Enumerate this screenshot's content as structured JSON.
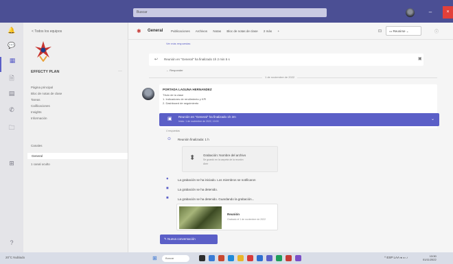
{
  "top_bar": {
    "search_text": "Buscar",
    "minimize_glyph": "–",
    "close_glyph": "×"
  },
  "rail": [
    {
      "icon": "bell-icon",
      "glyph": "🔔",
      "label": ""
    },
    {
      "icon": "chat-icon",
      "glyph": "💬",
      "label": ""
    },
    {
      "icon": "teams-icon",
      "glyph": "▦",
      "label": ""
    },
    {
      "icon": "assignments-icon",
      "glyph": "🗎",
      "label": ""
    },
    {
      "icon": "calendar-icon",
      "glyph": "▤",
      "label": ""
    },
    {
      "icon": "calls-icon",
      "glyph": "✆",
      "label": ""
    },
    {
      "icon": "files-icon",
      "glyph": "🗀",
      "label": ""
    },
    {
      "icon": "apps-icon",
      "glyph": "⊞",
      "label": ""
    },
    {
      "icon": "help-icon",
      "glyph": "?",
      "label": ""
    }
  ],
  "panel": {
    "back_label": "< Todos los equipos",
    "team_name": "EFFECTY PLAN",
    "more": "···",
    "nav_items": [
      "Página principal",
      "Bloc de notas de clase",
      "Tareas",
      "Calificaciones",
      "Insights",
      "Información"
    ],
    "channels_header": "Canales",
    "active_channel": "General",
    "hidden_channels": "1 canal oculto"
  },
  "channel": {
    "title": "General",
    "tabs": [
      "Publicaciones",
      "Archivos",
      "Notas",
      "Bloc de notas de clase",
      "2 más",
      "+"
    ],
    "meet_label": "Reunirse",
    "info_glyph": "ⓘ"
  },
  "feed": {
    "top_link": "Ver más respuestas",
    "reply_preview": "Reunión en \"General\" ha finalizado 1h 2 min 5 s",
    "reply_sub": "← Responder",
    "date_divider": "1 de noviembre de 2022",
    "post_author": "PORTADA LAGUNA HERNANDEZ",
    "post_line1": "Título de la clase",
    "post_line2": "1. Indicadores de rendimiento y KPI",
    "post_line3": "2. Dashboard de seguimiento",
    "banner_title": "Reunión en \"General\" ha finalizado 1h 2m",
    "banner_sub": "Inicio: 1 de noviembre de 2022, 10:00",
    "thread_label": "4 respuestas",
    "event1": "Reunión finalizada: 1 h",
    "rec_title": "Grabación: Nombre del archivo",
    "rec_sub": "Se guardó en la carpeta de la reunión",
    "rec_sub2": "Abrir",
    "event2": "La grabación se ha iniciado. Los miembros se notificaron",
    "event3": "La grabación se ha detenido.",
    "event4": "La grabación se ha detenido. Guardando la grabación...",
    "video_title": "Reunión",
    "video_sub": "Grabado el 1 de noviembre de 2022",
    "new_conversation": "Nueva conversación"
  },
  "taskbar": {
    "weather": "20°C Nublado",
    "search": "Buscar",
    "tray": "^ ESP LAA ◂ ▭ ♪",
    "time": "13:30",
    "date": "01/11/2022"
  },
  "colors": {
    "accent": "#5b5fc7",
    "topbar": "#4b4f94",
    "brand_red": "#e2403a"
  }
}
